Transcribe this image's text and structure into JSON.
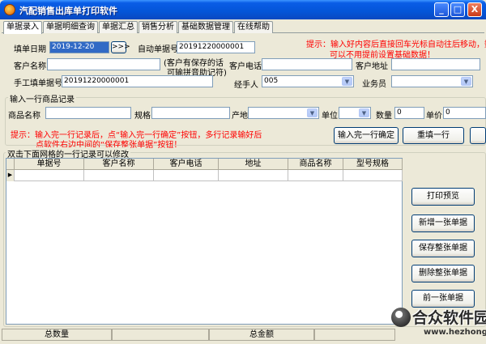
{
  "window": {
    "title": "汽配销售出库单打印软件",
    "min_label": "_",
    "max_label": "□",
    "close_label": "X"
  },
  "tabs": [
    {
      "label": "单据录入"
    },
    {
      "label": "单据明细查询"
    },
    {
      "label": "单据汇总"
    },
    {
      "label": "销售分析"
    },
    {
      "label": "基础数据管理"
    },
    {
      "label": "在线帮助"
    }
  ],
  "header": {
    "date_label": "填单日期",
    "date_value": "2019-12-20",
    "date_btn": ">>>",
    "auto_no_label": "自动单据号",
    "auto_no_value": "20191220000001",
    "hint_line1": "提示：输入好内容后直接回车光标自动往后移动，数",
    "hint_line2": "可以不用提前设置基础数据！",
    "customer_label": "客户名称",
    "customer_value": "",
    "customer_note_line1": "(客户有保存的话",
    "customer_note_line2": "可输拼音助记符)",
    "phone_label": "客户电话",
    "phone_value": "",
    "address_label": "客户地址",
    "address_value": "",
    "manual_no_label": "手工填单据号",
    "manual_no_value": "20191220000001",
    "handler_label": "经手人",
    "handler_value": "005",
    "sales_label": "业务员",
    "sales_value": ""
  },
  "entry": {
    "group_label": "输入一行商品记录",
    "product_label": "商品名称",
    "product_value": "",
    "spec_label": "规格",
    "spec_value": "",
    "origin_label": "产地",
    "origin_value": "",
    "unit_label": "单位",
    "unit_value": "",
    "qty_label": "数量",
    "qty_value": "0",
    "price_label": "单价",
    "price_value": "0",
    "hint_line1": "提示：输入完一行记录后，点“输入完一行确定”按钮，多行记录输好后",
    "hint_line2": "点软件右边中间的“保存整张单据”按钮！",
    "confirm_btn": "输入完一行确定",
    "refill_btn": "重填一行"
  },
  "grid": {
    "caption": "双击下面网格的一行记录可以修改",
    "columns": [
      "单据号",
      "客户名称",
      "客户电话",
      "地址",
      "商品名称",
      "型号规格"
    ]
  },
  "side_buttons": {
    "preview": "打印预览",
    "new": "新增一张单据",
    "save": "保存整张单据",
    "delete": "删除整张单据",
    "prev": "前一张单据"
  },
  "status": {
    "total_qty_label": "总数量",
    "total_amount_label": "总金额"
  },
  "watermark": {
    "name": "合众软件园",
    "url": "www.hezhong.net"
  },
  "colors": {
    "hint_red": "#ff0000",
    "title_blue": "#0455d8",
    "selection_blue": "#316ac5"
  }
}
